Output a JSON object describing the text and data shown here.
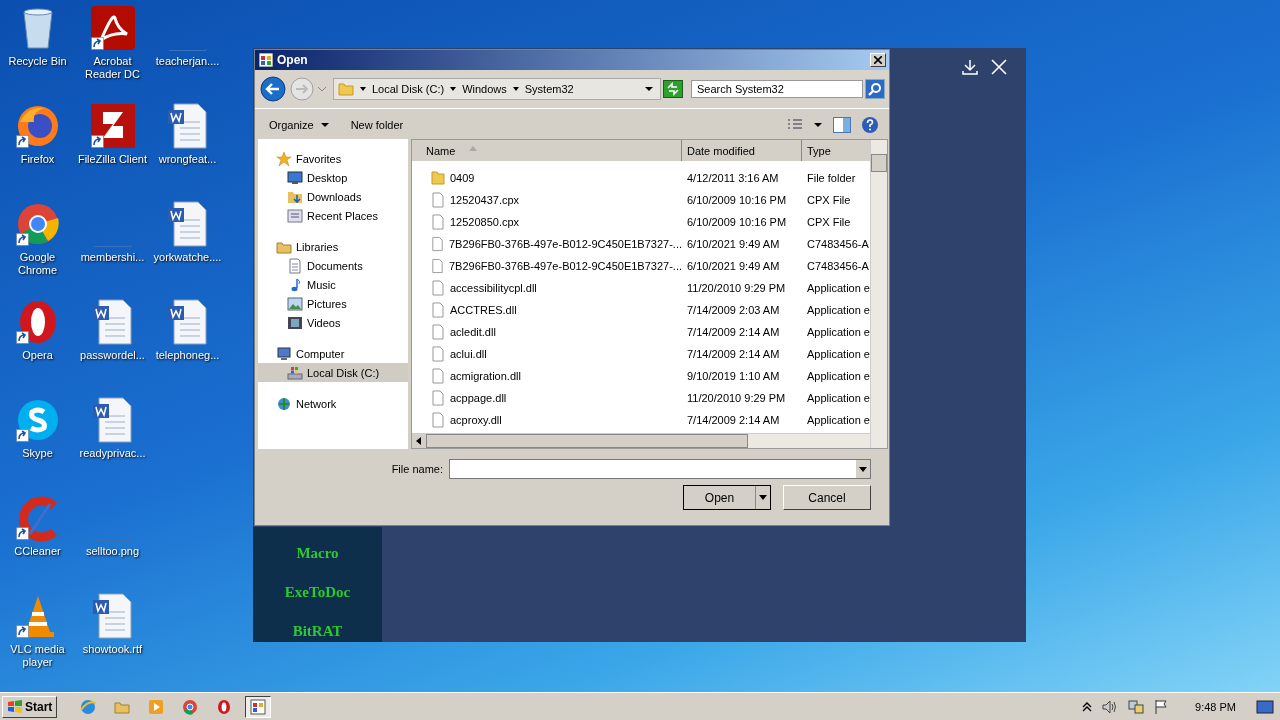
{
  "desktop_icons": [
    {
      "label": "Recycle Bin",
      "kind": "recycle",
      "shortcut": false
    },
    {
      "label": "Firefox",
      "kind": "firefox",
      "shortcut": true
    },
    {
      "label": "Google Chrome",
      "kind": "chrome",
      "shortcut": true
    },
    {
      "label": "Opera",
      "kind": "opera",
      "shortcut": true
    },
    {
      "label": "Skype",
      "kind": "skype",
      "shortcut": true
    },
    {
      "label": "CCleaner",
      "kind": "ccleaner",
      "shortcut": true
    },
    {
      "label": "VLC media player",
      "kind": "vlc",
      "shortcut": true
    },
    {
      "label": "Acrobat Reader DC",
      "kind": "pdf",
      "shortcut": true
    },
    {
      "label": "FileZilla Client",
      "kind": "filezilla",
      "shortcut": true
    },
    {
      "label": "membershi...",
      "kind": "blank",
      "shortcut": false
    },
    {
      "label": "passwordel...",
      "kind": "word",
      "shortcut": false
    },
    {
      "label": "readyprivac...",
      "kind": "word",
      "shortcut": false
    },
    {
      "label": "selltoo.png",
      "kind": "blank",
      "shortcut": false
    },
    {
      "label": "showtook.rtf",
      "kind": "word",
      "shortcut": false
    },
    {
      "label": "teacherjan....",
      "kind": "blank",
      "shortcut": false
    },
    {
      "label": "wrongfeat...",
      "kind": "word",
      "shortcut": false
    },
    {
      "label": "yorkwatche....",
      "kind": "word",
      "shortcut": false
    },
    {
      "label": "telephoneg...",
      "kind": "word",
      "shortcut": false
    }
  ],
  "back_app": {
    "sidebar_items": [
      "Macro",
      "ExeToDoc",
      "BitRAT"
    ]
  },
  "dialog": {
    "title": "Open",
    "breadcrumb": [
      "Local Disk (C:)",
      "Windows",
      "System32"
    ],
    "search": {
      "placeholder": "Search System32"
    },
    "toolbar": {
      "organize": "Organize",
      "new_folder": "New folder"
    },
    "nav": [
      {
        "label": "Favorites",
        "kind": "star",
        "selected": false,
        "children": [
          {
            "label": "Desktop",
            "kind": "desktop",
            "selected": false
          },
          {
            "label": "Downloads",
            "kind": "downloads",
            "selected": false
          },
          {
            "label": "Recent Places",
            "kind": "recent",
            "selected": false
          }
        ]
      },
      {
        "label": "Libraries",
        "kind": "library",
        "selected": false,
        "children": [
          {
            "label": "Documents",
            "kind": "documents",
            "selected": false
          },
          {
            "label": "Music",
            "kind": "music",
            "selected": false
          },
          {
            "label": "Pictures",
            "kind": "pictures",
            "selected": false
          },
          {
            "label": "Videos",
            "kind": "videos",
            "selected": false
          }
        ]
      },
      {
        "label": "Computer",
        "kind": "computer",
        "selected": false,
        "children": [
          {
            "label": "Local Disk (C:)",
            "kind": "disk",
            "selected": true
          }
        ]
      },
      {
        "label": "Network",
        "kind": "network",
        "selected": false
      }
    ],
    "columns": [
      "Name",
      "Date modified",
      "Type"
    ],
    "rows": [
      {
        "name": "0409",
        "date": "4/12/2011 3:16 AM",
        "type": "File folder",
        "kind": "folder"
      },
      {
        "name": "12520437.cpx",
        "date": "6/10/2009 10:16 PM",
        "type": "CPX File",
        "kind": "file"
      },
      {
        "name": "12520850.cpx",
        "date": "6/10/2009 10:16 PM",
        "type": "CPX File",
        "kind": "file"
      },
      {
        "name": "7B296FB0-376B-497e-B012-9C450E1B7327-...",
        "date": "6/10/2021 9:49 AM",
        "type": "C7483456-A",
        "kind": "file"
      },
      {
        "name": "7B296FB0-376B-497e-B012-9C450E1B7327-...",
        "date": "6/10/2021 9:49 AM",
        "type": "C7483456-A",
        "kind": "file"
      },
      {
        "name": "accessibilitycpl.dll",
        "date": "11/20/2010 9:29 PM",
        "type": "Application e",
        "kind": "file"
      },
      {
        "name": "ACCTRES.dll",
        "date": "7/14/2009 2:03 AM",
        "type": "Application e",
        "kind": "file"
      },
      {
        "name": "acledit.dll",
        "date": "7/14/2009 2:14 AM",
        "type": "Application e",
        "kind": "file"
      },
      {
        "name": "aclui.dll",
        "date": "7/14/2009 2:14 AM",
        "type": "Application e",
        "kind": "file"
      },
      {
        "name": "acmigration.dll",
        "date": "9/10/2019 1:10 AM",
        "type": "Application e",
        "kind": "file"
      },
      {
        "name": "acppage.dll",
        "date": "11/20/2010 9:29 PM",
        "type": "Application e",
        "kind": "file"
      },
      {
        "name": "acproxy.dll",
        "date": "7/14/2009 2:14 AM",
        "type": "Application e",
        "kind": "file"
      }
    ],
    "file_name_label": "File name:",
    "buttons": {
      "open": "Open",
      "cancel": "Cancel"
    }
  },
  "taskbar": {
    "start": "Start",
    "apps": [
      {
        "kind": "ie",
        "active": false
      },
      {
        "kind": "explorer",
        "active": false
      },
      {
        "kind": "media",
        "active": false
      },
      {
        "kind": "chrome",
        "active": false
      },
      {
        "kind": "opera",
        "active": false
      },
      {
        "kind": "dialog",
        "active": true
      }
    ],
    "clock": "9:48 PM"
  }
}
